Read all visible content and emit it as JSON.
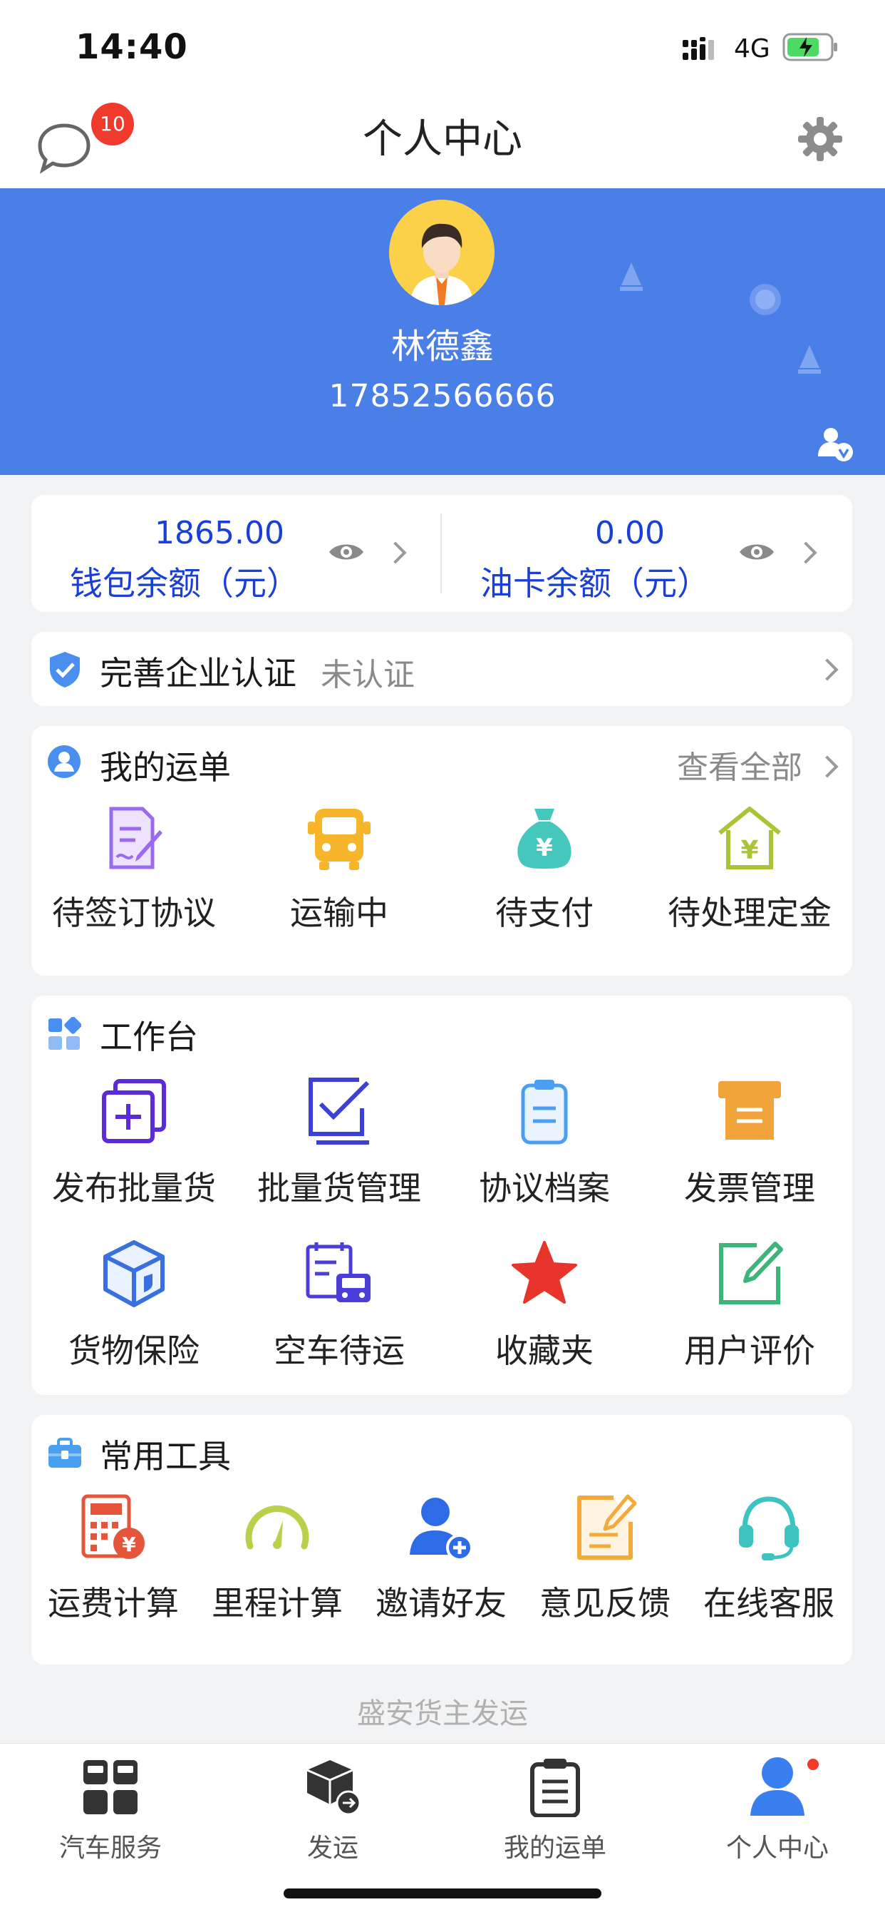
{
  "status_bar": {
    "time": "14:40",
    "network": "4G"
  },
  "header": {
    "title": "个人中心",
    "message_badge": "10"
  },
  "profile": {
    "name": "林德鑫",
    "phone": "17852566666"
  },
  "wallet": {
    "balance_value": "1865.00",
    "balance_label": "钱包余额（元）",
    "fuel_value": "0.00",
    "fuel_label": "油卡余额（元）"
  },
  "certification": {
    "title": "完善企业认证",
    "status": "未认证"
  },
  "orders": {
    "title": "我的运单",
    "view_all": "查看全部",
    "items": [
      {
        "label": "待签订协议",
        "icon": "sign-document-icon"
      },
      {
        "label": "运输中",
        "icon": "truck-icon"
      },
      {
        "label": "待支付",
        "icon": "money-bag-icon"
      },
      {
        "label": "待处理定金",
        "icon": "deposit-house-icon"
      }
    ]
  },
  "workbench": {
    "title": "工作台",
    "items": [
      {
        "label": "发布批量货",
        "icon": "publish-bulk-icon"
      },
      {
        "label": "批量货管理",
        "icon": "bulk-manage-icon"
      },
      {
        "label": "协议档案",
        "icon": "clipboard-icon"
      },
      {
        "label": "发票管理",
        "icon": "invoice-icon"
      },
      {
        "label": "货物保险",
        "icon": "insurance-box-icon"
      },
      {
        "label": "空车待运",
        "icon": "empty-truck-icon"
      },
      {
        "label": "收藏夹",
        "icon": "star-icon"
      },
      {
        "label": "用户评价",
        "icon": "edit-review-icon"
      }
    ]
  },
  "tools": {
    "title": "常用工具",
    "items": [
      {
        "label": "运费计算",
        "icon": "calculator-icon"
      },
      {
        "label": "里程计算",
        "icon": "gauge-icon"
      },
      {
        "label": "邀请好友",
        "icon": "add-user-icon"
      },
      {
        "label": "意见反馈",
        "icon": "feedback-icon"
      },
      {
        "label": "在线客服",
        "icon": "headset-icon"
      }
    ]
  },
  "brand_footer": "盛安货主发运",
  "tabbar": {
    "items": [
      {
        "label": "汽车服务",
        "icon": "car-service-icon"
      },
      {
        "label": "发运",
        "icon": "ship-box-icon"
      },
      {
        "label": "我的运单",
        "icon": "clipboard-list-icon"
      },
      {
        "label": "个人中心",
        "icon": "person-icon"
      }
    ]
  },
  "colors": {
    "primary": "#4a7fe8",
    "wallet_text": "#1a3fd6",
    "badge": "#f03a2b"
  }
}
